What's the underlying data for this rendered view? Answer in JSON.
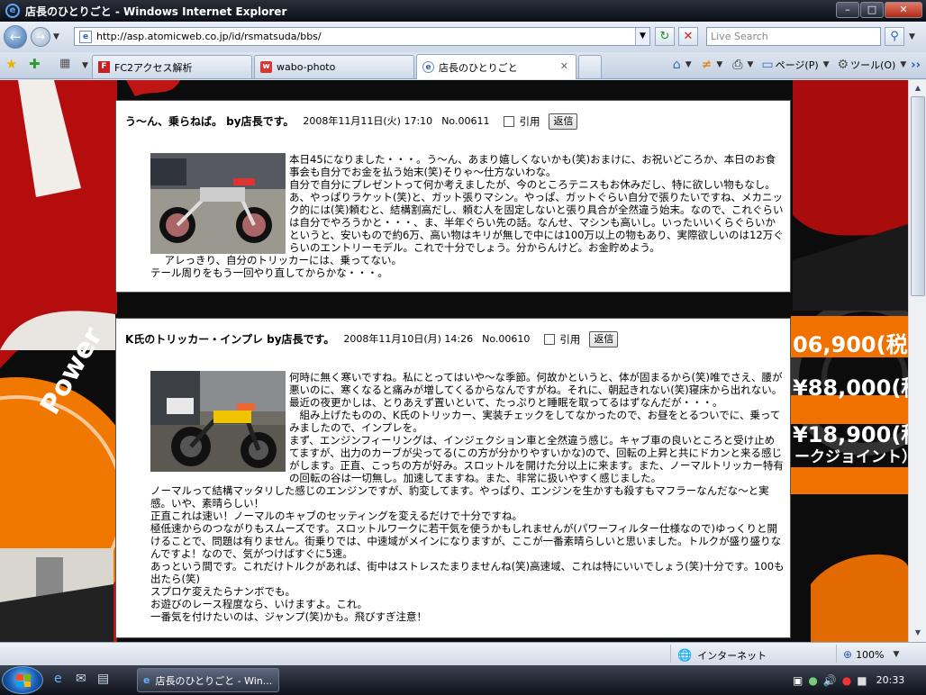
{
  "window": {
    "title": "店長のひとりごと - Windows Internet Explorer"
  },
  "address": {
    "url": "http://asp.atomicweb.co.jp/id/rsmatsuda/bbs/"
  },
  "search": {
    "placeholder": "Live Search"
  },
  "tabs": [
    {
      "label": "FC2アクセス解析",
      "icon": "fc2-icon"
    },
    {
      "label": "wabo-photo",
      "icon": "page-icon"
    },
    {
      "label": "店長のひとりごと",
      "icon": "ie-icon"
    }
  ],
  "toolbar": {
    "page_label": "ページ(P)",
    "tools_label": "ツール(O)"
  },
  "posts": [
    {
      "title": "う～ん、乗らねば。 by店長です。",
      "date": "2008年11月11日(火) 17:10",
      "number": "No.00611",
      "quote_label": "引用",
      "reply_label": "返信",
      "lines": [
        "本日45になりました・・・。う～ん、あまり嬉しくないかも(笑)おまけに、お祝いどころか、本日のお食事会も自分でお金を払う始末(笑)そりゃ～仕方ないわな。",
        "自分で自分にプレゼントって何か考えましたが、今のところテニスもお休みだし、特に欲しい物もなし。",
        "あ、やっぱりラケット(笑)と、ガット張りマシン。やっぱ、ガットぐらい自分で張りたいですね、メカニック的には(笑)頼むと、結構割高だし、頼む人を固定しないと張り具合が全然違う始末。なので、これぐらいは自分でやろうかと・・・、ま、半年ぐらい先の話。なんせ、マシンも高いし。いったいいくらぐらいかというと、安いもので約6万、高い物はキリが無しで中には100万以上の物もあり、実際欲しいのは12万ぐらいのエントリーモデル。これで十分でしょう。分からんけど。お金貯めよう。",
        "　アレっきり、自分のトリッカーには、乗ってない。",
        "テール周りをもう一回やり直してからかな・・・。"
      ]
    },
    {
      "title": "K氏のトリッカー・インプレ by店長です。",
      "date": "2008年11月10日(月) 14:26",
      "number": "No.00610",
      "quote_label": "引用",
      "reply_label": "返信",
      "lines": [
        "何時に無く寒いですね。私にとってはいや～な季節。何故かというと、体が固まるから(笑)唯でさえ、腰が悪いのに、寒くなると痛みが増してくるからなんですがね。それに、朝起きれない(笑)寝床から出れない。最近の夜更かしは、とりあえず置いといて、たっぷりと睡眠を取ってるはずなんだが・・・。",
        "　組み上げたものの、K氏のトリッカー、実装チェックをしてなかったので、お昼をとるついでに、乗ってみましたので、インプレを。",
        "まず、エンジンフィーリングは、インジェクション車と全然違う感じ。キャブ車の良いところと受け止めてますが、出力のカーブが尖ってる(この方が分かりやすいかな)ので、回転の上昇と共にドカンと来る感じがします。正直、こっちの方が好み。スロットルを開けた分以上に来ます。また、ノーマルトリッカー特有の回転の谷は一切無し。加速してますね。また、非常に扱いやすく感じました。",
        "ノーマルって結構マッタリした感じのエンジンですが、豹変してます。やっぱり、エンジンを生かすも殺すもマフラーなんだな～と実感。いや、素晴らしい！",
        "正直これは速い！ノーマルのキャブのセッティングを変えるだけで十分ですね。",
        "極低速からのつながりもスムーズです。スロットルワークに若干気を使うかもしれませんが(パワーフィルター仕様なので)ゆっくりと開けることで、問題は有りません。街乗りでは、中速域がメインになりますが、ここが一番素晴らしいと思いました。トルクが盛り盛りなんですよ！なので、気がつけばすぐに5速。",
        "あっという間です。これだけトルクがあれば、街中はストレスたまりませんね(笑)高速域、これは特にいいでしょう(笑)十分です。100も出たら(笑)",
        "スプロケ変えたらナンボでも。",
        "お遊びのレース程度なら、いけますよ。これ。",
        "一番気を付けたいのは、ジャンプ(笑)かも。飛びすぎ注意！"
      ]
    }
  ],
  "ad": {
    "price1": "06,900(税",
    "price2": "¥88,000(税",
    "price3": "¥18,900(税",
    "joint": "ークジョイント）",
    "power": "Power"
  },
  "status": {
    "zone": "インターネット",
    "zoom": "100%"
  },
  "taskbar": {
    "window_label": "店長のひとりごと - Win...",
    "clock": "20:33"
  }
}
